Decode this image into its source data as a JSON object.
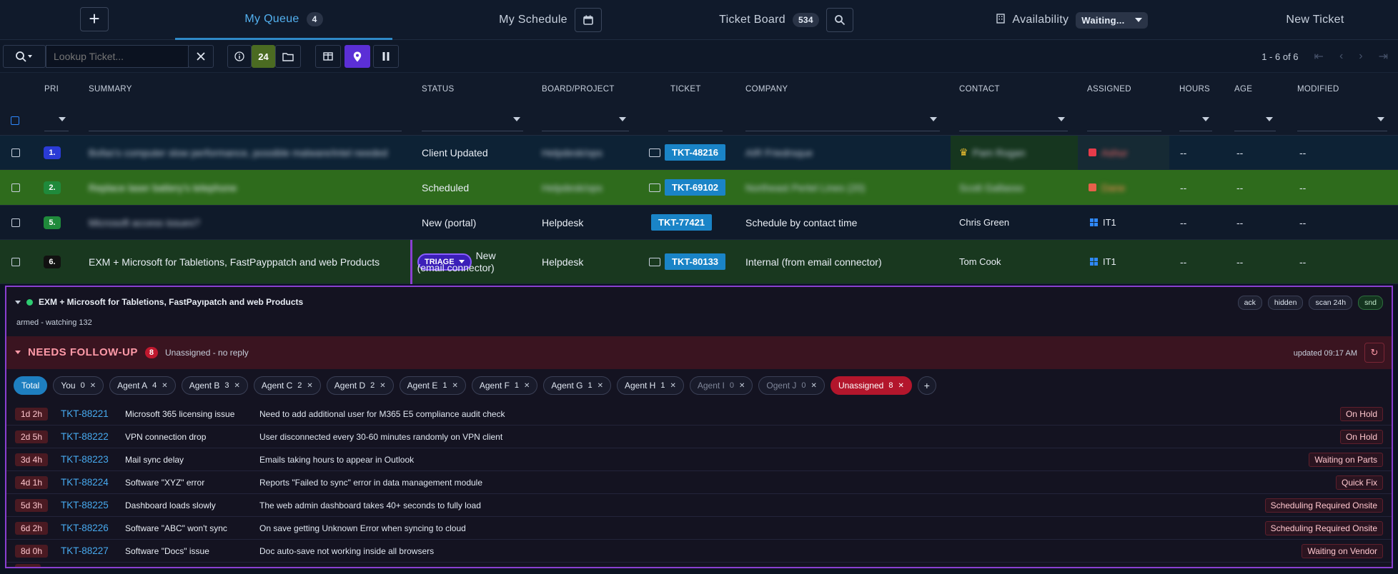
{
  "nav": {
    "tabs": [
      {
        "label": "My Queue",
        "count": "4"
      },
      {
        "label": "My Schedule"
      },
      {
        "label": "Ticket Board",
        "count": "534"
      },
      {
        "label": "Availability",
        "status": "Waiting..."
      },
      {
        "label": "New Ticket"
      }
    ]
  },
  "toolbar": {
    "search_placeholder": "Lookup Ticket...",
    "filter_count": "24",
    "pager_text": "1 - 6 of 6"
  },
  "columns": [
    "PRI",
    "SUMMARY",
    "STATUS",
    "BOARD/PROJECT",
    "TICKET",
    "COMPANY",
    "CONTACT",
    "ASSIGNED",
    "HOURS",
    "AGE",
    "MODIFIED"
  ],
  "rows": [
    {
      "pri": "1.",
      "pri_color": "#2a3bd6",
      "summary": "Bofas's computer slow performance, possible malware/intel needed",
      "status": "Client Updated",
      "board": "Helpdesk/ops",
      "ticket": "TKT-48216",
      "company": "AIR Friedrsque",
      "contact": "Pam Rogan",
      "assigned": "Ashur",
      "hours": "--",
      "age": "--",
      "modified": "--"
    },
    {
      "pri": "2.",
      "pri_color": "#1f8a3b",
      "summary": "Replace laser battery's telephone",
      "status": "Scheduled",
      "board": "Helpdesk/ops",
      "ticket": "TKT-69102",
      "company": "Northeast Pertel Lines (20)",
      "contact": "Scott Gallasso",
      "assigned": "Dane",
      "hours": "--",
      "age": "--",
      "modified": "--"
    },
    {
      "pri": "5.",
      "pri_color": "#1f8a3b",
      "summary": "Microsoft access issues?",
      "status": "New (portal)",
      "board": "Helpdesk",
      "ticket": "TKT-77421",
      "company": "Schedule by contact time",
      "contact": "Chris Green",
      "assigned": "IT1",
      "hours": "--",
      "age": "--",
      "modified": "--"
    },
    {
      "pri": "6.",
      "pri_color": "#111111",
      "summary": "EXM + Microsoft for Tabletions, FastPayppatch and web Products",
      "status_badge": "TRIAGE",
      "status_line1": "New",
      "status_line2": "(email connector)",
      "board": "Helpdesk",
      "ticket": "TKT-80133",
      "company": "Internal (from email connector)",
      "contact": "Tom Cook",
      "assigned": "IT1",
      "hours": "--",
      "age": "--",
      "modified": "--"
    }
  ],
  "panel": {
    "title": "EXM + Microsoft for Tabletions, FastPayıpatch and web Products",
    "chips": [
      "ack",
      "hidden",
      "scan 24h",
      "snd"
    ],
    "armed": "armed - watching 132",
    "followup": {
      "label": "NEEDS FOLLOW-UP",
      "count": "8",
      "sub": "Unassigned - no reply",
      "updated": "updated 09:17 AM"
    },
    "agents": [
      {
        "name": "Total"
      },
      {
        "name": "You",
        "n": "0"
      },
      {
        "name": "Agent A",
        "n": "4"
      },
      {
        "name": "Agent B",
        "n": "3"
      },
      {
        "name": "Agent C",
        "n": "2"
      },
      {
        "name": "Agent D",
        "n": "2"
      },
      {
        "name": "Agent E",
        "n": "1"
      },
      {
        "name": "Agent F",
        "n": "1"
      },
      {
        "name": "Agent G",
        "n": "1"
      },
      {
        "name": "Agent H",
        "n": "1"
      },
      {
        "name": "Agent I",
        "n": "0"
      },
      {
        "name": "Ogent J",
        "n": "0"
      },
      {
        "name": "Unassigned",
        "n": "8"
      }
    ],
    "items": [
      {
        "age": "1d 2h",
        "ticket": "TKT-88221",
        "summary": "Microsoft 365 licensing issue",
        "desc": "Need to add additional user for M365 E5 compliance audit check",
        "status": "On Hold"
      },
      {
        "age": "2d 5h",
        "ticket": "TKT-88222",
        "summary": "VPN connection drop",
        "desc": "User disconnected every 30-60 minutes randomly on VPN client",
        "status": "On Hold"
      },
      {
        "age": "3d 4h",
        "ticket": "TKT-88223",
        "summary": "Mail sync delay",
        "desc": "Emails taking hours to appear in Outlook",
        "status": "Waiting on Parts"
      },
      {
        "age": "4d 1h",
        "ticket": "TKT-88224",
        "summary": "Software \"XYZ\" error",
        "desc": "Reports \"Failed to sync\" error in data management module",
        "status": "Quick Fix"
      },
      {
        "age": "5d 3h",
        "ticket": "TKT-88225",
        "summary": "Dashboard loads slowly",
        "desc": "The web admin dashboard takes 40+ seconds to fully load",
        "status": "Scheduling Required Onsite"
      },
      {
        "age": "6d 2h",
        "ticket": "TKT-88226",
        "summary": "Software \"ABC\" won't sync",
        "desc": "On save getting Unknown Error when syncing to cloud",
        "status": "Scheduling Required Onsite"
      },
      {
        "age": "8d 0h",
        "ticket": "TKT-88227",
        "summary": "Software \"Docs\" issue",
        "desc": "Doc auto-save not working inside all browsers",
        "status": "Waiting on Vendor"
      }
    ]
  }
}
